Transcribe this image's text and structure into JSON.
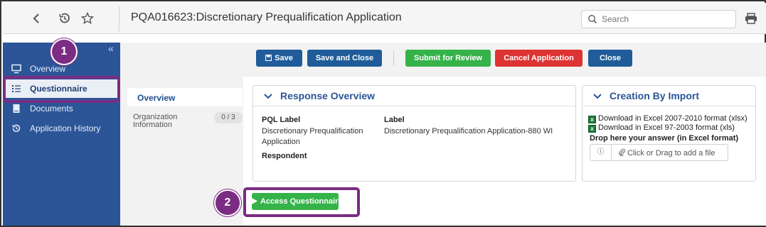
{
  "topbar": {
    "title": "PQA016623:Discretionary Prequalification Application",
    "search_placeholder": "Search"
  },
  "sidebar": {
    "items": [
      {
        "label": "Overview",
        "icon": "monitor-icon"
      },
      {
        "label": "Questionnaire",
        "icon": "list-icon"
      },
      {
        "label": "Documents",
        "icon": "document-icon"
      },
      {
        "label": "Application History",
        "icon": "history-icon"
      }
    ]
  },
  "toolbar": {
    "save_label": "Save",
    "save_close_label": "Save and Close",
    "submit_label": "Submit for Review",
    "cancel_label": "Cancel Application",
    "close_label": "Close"
  },
  "subnav": {
    "overview_label": "Overview",
    "org_label": "Organization Information",
    "org_count": "0 / 3"
  },
  "response_overview": {
    "title": "Response Overview",
    "pql_label_heading": "PQL Label",
    "pql_label_value": "Discretionary Prequalification Application",
    "label_heading": "Label",
    "label_value": "Discretionary Prequalification Application-880 WI",
    "respondent_heading": "Respondent"
  },
  "creation_by_import": {
    "title": "Creation By Import",
    "download_xlsx": "Download in Excel 2007-2010 format (xlsx)",
    "download_xls": "Download in Excel 97-2003 format (xls)",
    "drop_label": "Drop here your answer (in Excel format)",
    "upload_text": "Click or Drag to add a file"
  },
  "access_button_label": "Access Questionnaire",
  "annotations": {
    "badge_1": "1",
    "badge_2": "2"
  },
  "colors": {
    "sidebar": "#2b5597",
    "highlight": "#7b2c83",
    "button_blue": "#1f5c99",
    "button_green": "#35b34a",
    "button_red": "#dd3333"
  }
}
